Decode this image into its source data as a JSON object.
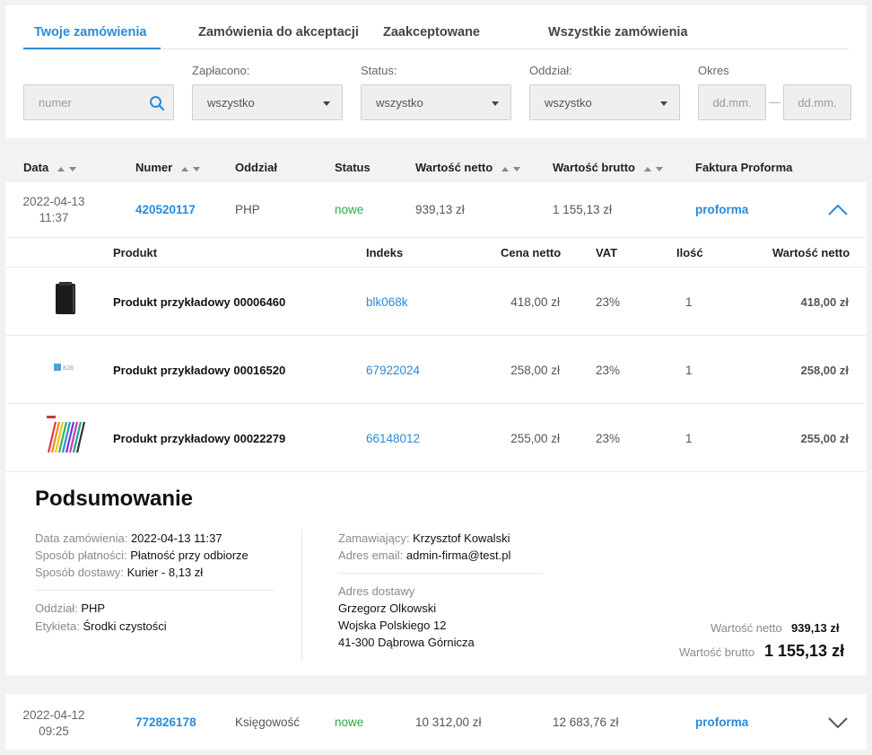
{
  "tabs": [
    {
      "label": "Twoje zamówienia",
      "active": true
    },
    {
      "label": "Zamówienia do akceptacji",
      "active": false
    },
    {
      "label": "Zaakceptowane",
      "active": false
    },
    {
      "label": "Wszystkie zamówienia",
      "active": false
    }
  ],
  "filters": {
    "number_placeholder": "numer",
    "paid_label": "Zapłacono:",
    "paid_value": "wszystko",
    "status_label": "Status:",
    "status_value": "wszystko",
    "branch_label": "Oddział:",
    "branch_value": "wszystko",
    "period_label": "Okres",
    "date_from_placeholder": "dd.mm.",
    "date_to_placeholder": "dd.mm.",
    "date_sep": "—"
  },
  "table_headers": {
    "date": "Data",
    "number": "Numer",
    "branch": "Oddział",
    "status": "Status",
    "net": "Wartość netto",
    "gross": "Wartość brutto",
    "proforma": "Faktura Proforma"
  },
  "orders": [
    {
      "date": "2022-04-13",
      "time": "11:37",
      "number": "420520117",
      "branch": "PHP",
      "status": "nowe",
      "net": "939,13 zł",
      "gross": "1 155,13 zł",
      "proforma": "proforma",
      "expanded": true
    },
    {
      "date": "2022-04-12",
      "time": "09:25",
      "number": "772826178",
      "branch": "Księgowość",
      "status": "nowe",
      "net": "10 312,00 zł",
      "gross": "12 683,76 zł",
      "proforma": "proforma",
      "expanded": false
    }
  ],
  "product_headers": {
    "product": "Produkt",
    "index": "Indeks",
    "net_price": "Cena netto",
    "vat": "VAT",
    "qty": "Ilość",
    "net_value": "Wartość netto"
  },
  "products": [
    {
      "name": "Produkt przykładowy 00006460",
      "index": "blk068k",
      "net_price": "418,00 zł",
      "vat": "23%",
      "qty": "1",
      "net_value": "418,00 zł",
      "thumb": "black-notebook"
    },
    {
      "name": "Produkt przykładowy 00016520",
      "index": "67922024",
      "net_price": "258,00 zł",
      "vat": "23%",
      "qty": "1",
      "net_value": "258,00 zł",
      "thumb": "b2b-logo",
      "thumb_text": "B2B"
    },
    {
      "name": "Produkt przykładowy 00022279",
      "index": "66148012",
      "net_price": "255,00 zł",
      "vat": "23%",
      "qty": "1",
      "net_value": "255,00 zł",
      "thumb": "colored-pens"
    }
  ],
  "summary": {
    "title": "Podsumowanie",
    "order_date_label": "Data zamówienia:",
    "order_date": "2022-04-13 11:37",
    "payment_label": "Sposób płatności:",
    "payment": "Płatność przy odbiorze",
    "delivery_label": "Sposób dostawy:",
    "delivery": "Kurier - 8,13 zł",
    "branch_label": "Oddział:",
    "branch": "PHP",
    "tag_label": "Etykieta:",
    "tag": "Środki czystości",
    "orderer_label": "Zamawiający:",
    "orderer": "Krzysztof Kowalski",
    "email_label": "Adres email:",
    "email": "admin-firma@test.pl",
    "address_label": "Adres dostawy",
    "address_name": "Grzegorz Olkowski",
    "address_street": "Wojska Polskiego 12",
    "address_city": "41-300 Dąbrowa Górnicza",
    "net_label": "Wartość netto",
    "net": "939,13 zł",
    "gross_label": "Wartość brutto",
    "gross": "1 155,13 zł"
  },
  "colors": {
    "accent": "#2a8bd8",
    "status_new": "#2aa84a"
  }
}
